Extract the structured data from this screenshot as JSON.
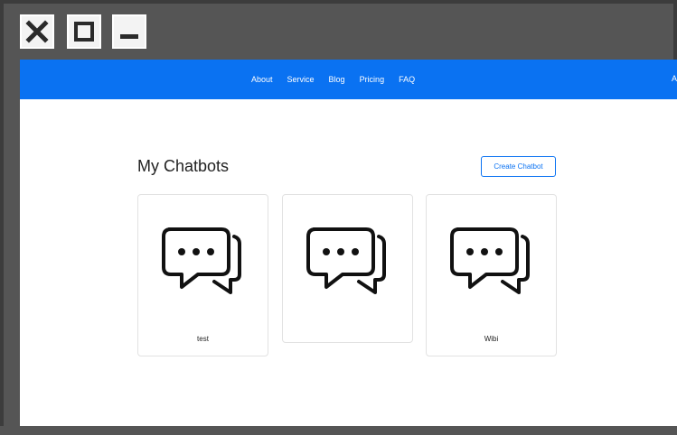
{
  "window": {
    "controls": [
      {
        "name": "close-icon"
      },
      {
        "name": "maximize-icon"
      },
      {
        "name": "minimize-icon"
      }
    ]
  },
  "navbar": {
    "links": [
      "About",
      "Service",
      "Blog",
      "Pricing",
      "FAQ"
    ],
    "edge_text": "A"
  },
  "main": {
    "title": "My Chatbots",
    "create_button": "Create Chatbot",
    "chatbots": [
      {
        "name": "test",
        "icon": "chat-bubbles-icon"
      },
      {
        "name": "",
        "icon": "chat-bubbles-icon"
      },
      {
        "name": "Wibi",
        "icon": "chat-bubbles-icon"
      }
    ]
  },
  "colors": {
    "navbar": "#0a72f2",
    "frame": "#555555",
    "accent": "#0a72f2"
  }
}
